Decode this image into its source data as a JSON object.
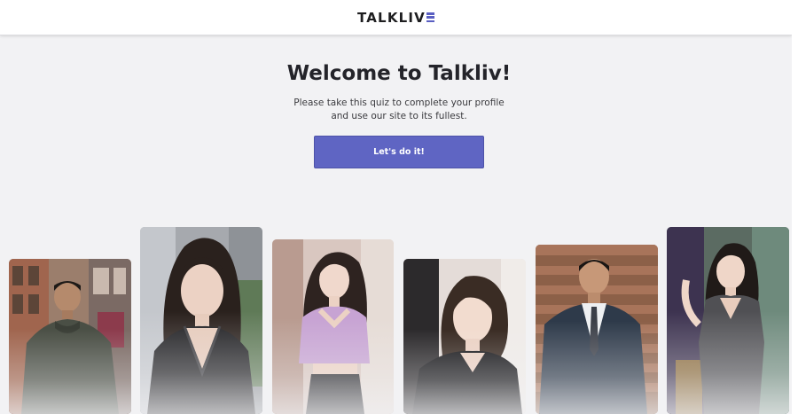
{
  "header": {
    "logo_text": "TALKLIV",
    "logo_letter_icon": "three-bar-e-icon",
    "accent_color": "#5a5fc2"
  },
  "hero": {
    "title": "Welcome to Talkliv!",
    "subtitle_line1": "Please take this quiz to complete your profile",
    "subtitle_line2": "and use our site to its fullest.",
    "cta_label": "Let's do it!",
    "cta_color": "#5f65c3"
  },
  "photos": [
    {
      "name": "man-green-hoodie-photo"
    },
    {
      "name": "woman-black-lace-top-photo"
    },
    {
      "name": "woman-lilac-top-photo"
    },
    {
      "name": "woman-short-hair-photo"
    },
    {
      "name": "man-suit-photo"
    },
    {
      "name": "woman-grey-dress-photo"
    }
  ]
}
